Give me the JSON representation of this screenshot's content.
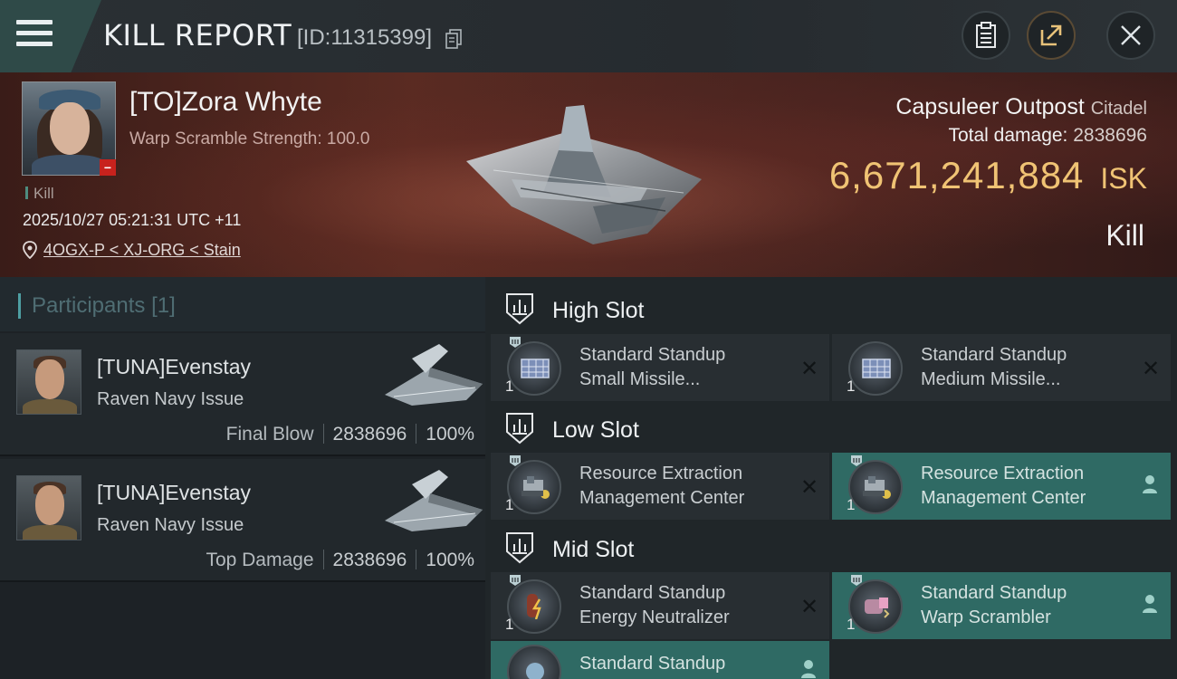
{
  "header": {
    "title": "KILL REPORT",
    "report_id": "[ID:11315399]"
  },
  "victim": {
    "name": "[TO]Zora Whyte",
    "warp_scramble": "Warp Scramble Strength: 100.0",
    "kill_tag": "Kill",
    "time": "2025/10/27 05:21:31 UTC +11",
    "location": "4OGX-P < XJ-ORG < Stain",
    "ship_name": "Capsuleer Outpost",
    "ship_class": "Citadel",
    "total_damage_label": "Total damage:",
    "total_damage": "2838696",
    "isk_value": "6,671,241,884",
    "isk_currency": "ISK",
    "result": "Kill"
  },
  "participants": {
    "label": "Participants",
    "count": "[1]",
    "rows": [
      {
        "name": "[TUNA]Evenstay",
        "ship": "Raven Navy Issue",
        "role": "Final Blow",
        "damage": "2838696",
        "percent": "100%"
      },
      {
        "name": "[TUNA]Evenstay",
        "ship": "Raven Navy Issue",
        "role": "Top Damage",
        "damage": "2838696",
        "percent": "100%"
      }
    ]
  },
  "slots": {
    "high": {
      "label": "High Slot",
      "modules": [
        {
          "line1": "Standard Standup",
          "line2": "Small Missile...",
          "qty": "1",
          "state": "destroyed"
        },
        {
          "line1": "Standard Standup",
          "line2": "Medium Missile...",
          "qty": "1",
          "state": "destroyed"
        }
      ]
    },
    "low": {
      "label": "Low Slot",
      "modules": [
        {
          "line1": "Resource Extraction",
          "line2": "Management Center",
          "qty": "1",
          "state": "destroyed"
        },
        {
          "line1": "Resource Extraction",
          "line2": "Management Center",
          "qty": "1",
          "state": "dropped"
        }
      ]
    },
    "mid": {
      "label": "Mid Slot",
      "modules": [
        {
          "line1": "Standard Standup",
          "line2": "Energy Neutralizer",
          "qty": "1",
          "state": "destroyed"
        },
        {
          "line1": "Standard Standup",
          "line2": "Warp Scrambler",
          "qty": "1",
          "state": "dropped"
        },
        {
          "line1": "Standard Standup",
          "line2": "",
          "qty": "",
          "state": "dropped"
        }
      ]
    }
  },
  "icons": {
    "menu": "hamburger-menu-icon",
    "copy": "copy-icon",
    "clipboard": "clipboard-icon",
    "share": "share-icon",
    "close": "close-icon",
    "location": "location-pin-icon",
    "slot": "shield-slot-icon",
    "destroyed": "x-mark-icon",
    "dropped": "person-icon"
  },
  "colors": {
    "isk_gold": "#f0c374",
    "dropped_green": "#2f6a64",
    "banner_red": "#5a2b22",
    "accent_teal": "#4e9fa3"
  }
}
